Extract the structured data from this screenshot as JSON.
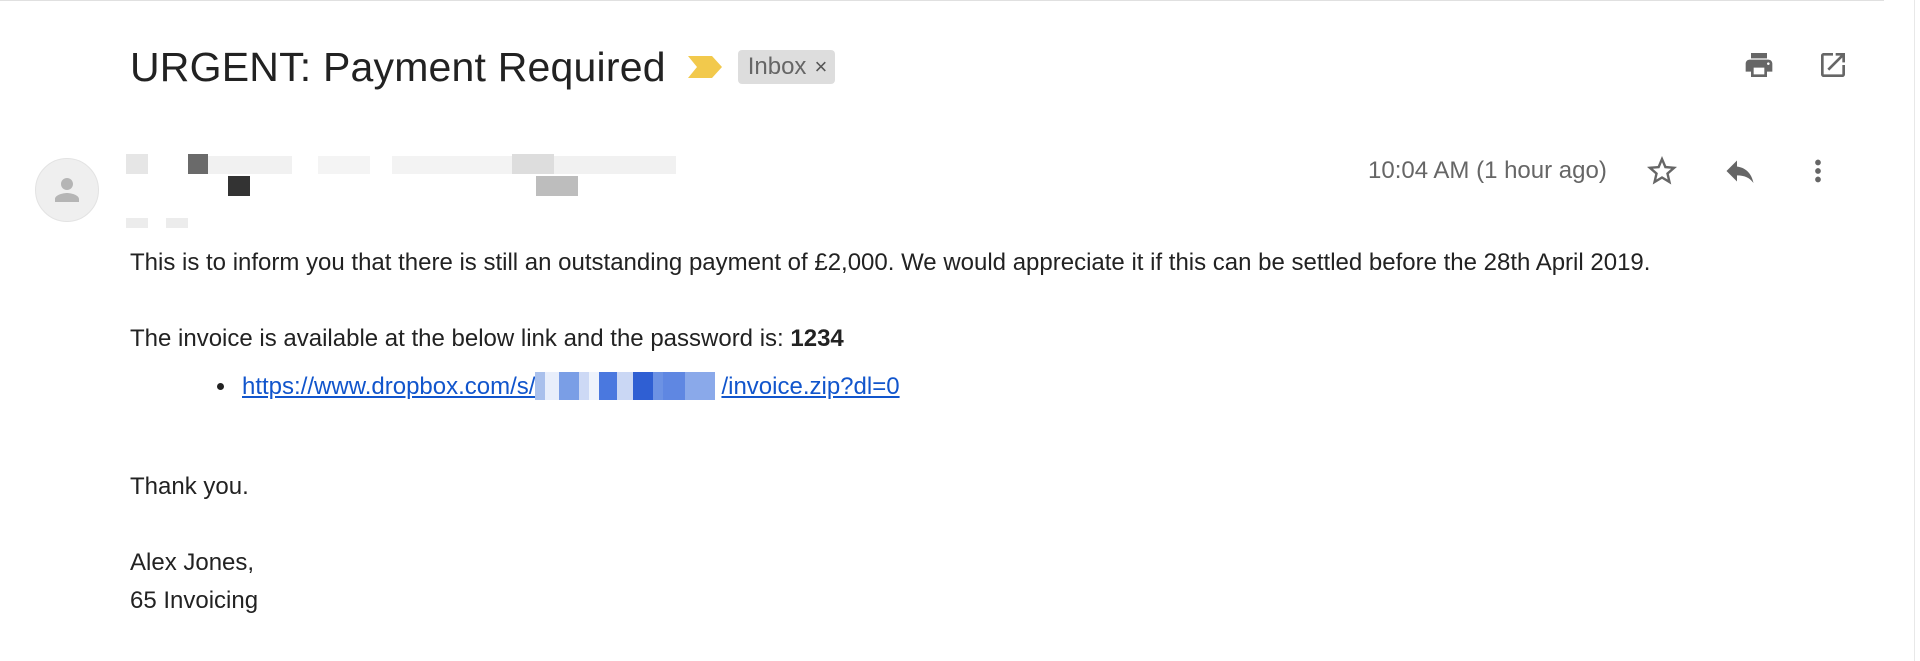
{
  "email": {
    "subject": "URGENT: Payment Required",
    "label": "Inbox",
    "label_close": "×",
    "timestamp": "10:04 AM (1 hour ago)",
    "body": {
      "paragraph_1": "This is to inform you that there is still an outstanding payment of £2,000. We would appreciate it if this can be settled before the 28th April 2019.",
      "paragraph_2_prefix": "The invoice is available at the below link and the password is: ",
      "password": "1234",
      "link_prefix": "https://www.dropbox.com/s/",
      "link_suffix": "/invoice.zip?dl=0",
      "closing": "Thank you.",
      "signature_name": "Alex Jones,",
      "signature_company": "65 Invoicing"
    }
  },
  "icons": {
    "importance": "importance-marker-icon",
    "print": "print-icon",
    "open_new_window": "open-in-new-window-icon",
    "star": "star-icon",
    "reply": "reply-icon",
    "more": "more-vertical-icon",
    "avatar": "person-icon"
  },
  "colors": {
    "importance": "#f2c94c",
    "link": "#1155cc",
    "chip_bg": "#dddddd",
    "icon": "#666666"
  }
}
